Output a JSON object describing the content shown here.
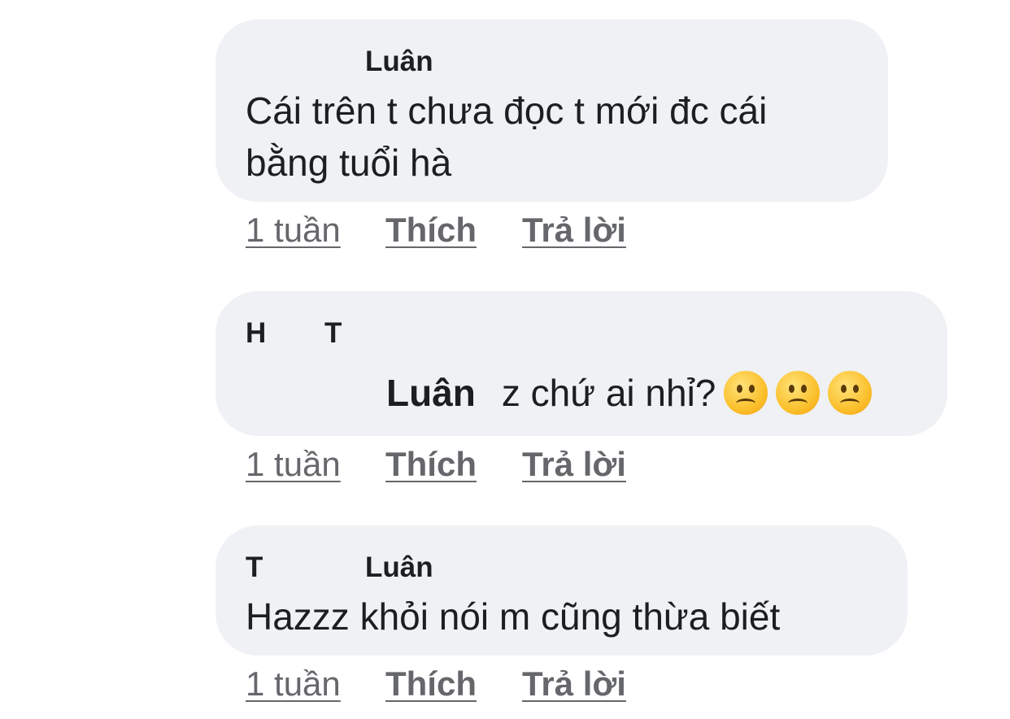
{
  "comments": [
    {
      "author": "Luân",
      "lines": [
        "Cái trên t chưa đọc t mới đc cái",
        "bằng tuổi hà"
      ],
      "time": "1 tuần",
      "like": "Thích",
      "reply": "Trả lời"
    },
    {
      "author": "H",
      "author_second": "T",
      "mention": "Luân",
      "text": "z chứ ai nhỉ?",
      "emoji": [
        "frowning-face-icon",
        "frowning-face-icon",
        "frowning-face-icon"
      ],
      "time": "1 tuần",
      "like": "Thích",
      "reply": "Trả lời"
    },
    {
      "author": "T",
      "author_second": "Luân",
      "text": "Hazzz khỏi nói m cũng thừa biết",
      "time": "1 tuần",
      "like": "Thích",
      "reply": "Trả lời"
    }
  ]
}
